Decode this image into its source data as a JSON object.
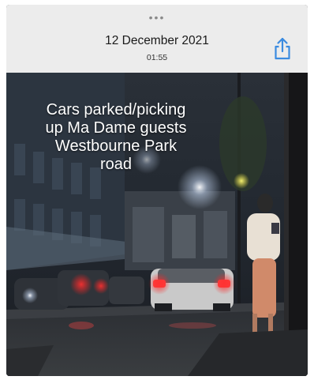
{
  "header": {
    "more_dots": "•••",
    "date": "12 December 2021",
    "time": "01:55",
    "share_icon": "share-icon",
    "accent": "#3b8be0"
  },
  "photo": {
    "caption_lines": [
      "Cars parked/picking",
      "up Ma Dame guests",
      "Westbourne Park",
      "road"
    ]
  }
}
